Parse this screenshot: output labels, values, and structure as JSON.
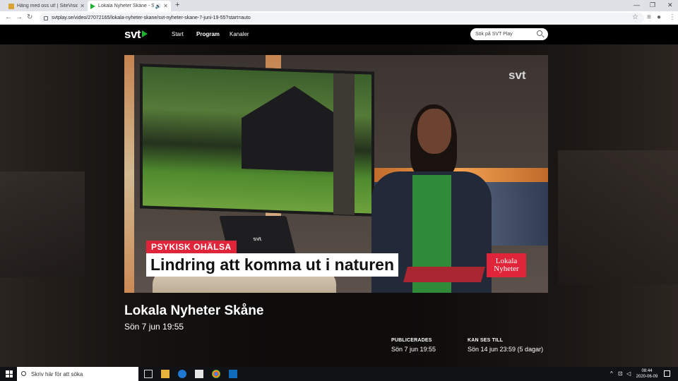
{
  "browser": {
    "tabs": [
      {
        "label": "Häng med oss ut! | SiteVision"
      },
      {
        "label": "Lokala Nyheter Skåne - Sön"
      }
    ],
    "url": "svtplay.se/video/27072165/lokala-nyheter-skane/svt-nyheter-skane-7-juni-19-55?start=auto"
  },
  "header": {
    "logo": "svt",
    "nav": [
      "Start",
      "Program",
      "Kanaler"
    ],
    "search_placeholder": "Sök på SVT Play"
  },
  "video": {
    "kicker": "PSYKISK OHÄLSA",
    "headline": "Lindring att komma ut i naturen",
    "brand_line1": "Lokala",
    "brand_line2": "Nyheter",
    "bug": "svt",
    "laptop_logo": "svt"
  },
  "program": {
    "title": "Lokala Nyheter Skåne",
    "subtitle": "Sön 7 jun 19:55",
    "published_label": "PUBLICERADES",
    "published_value": "Sön 7 jun 19:55",
    "available_label": "KAN SES TILL",
    "available_value": "Sön 14 jun 23:59 (5 dagar)"
  },
  "taskbar": {
    "search_placeholder": "Skriv här för att söka",
    "time": "08:44",
    "date": "2020-06-09"
  },
  "colors": {
    "svt_green": "#1db232",
    "kicker_red": "#e0243a"
  }
}
